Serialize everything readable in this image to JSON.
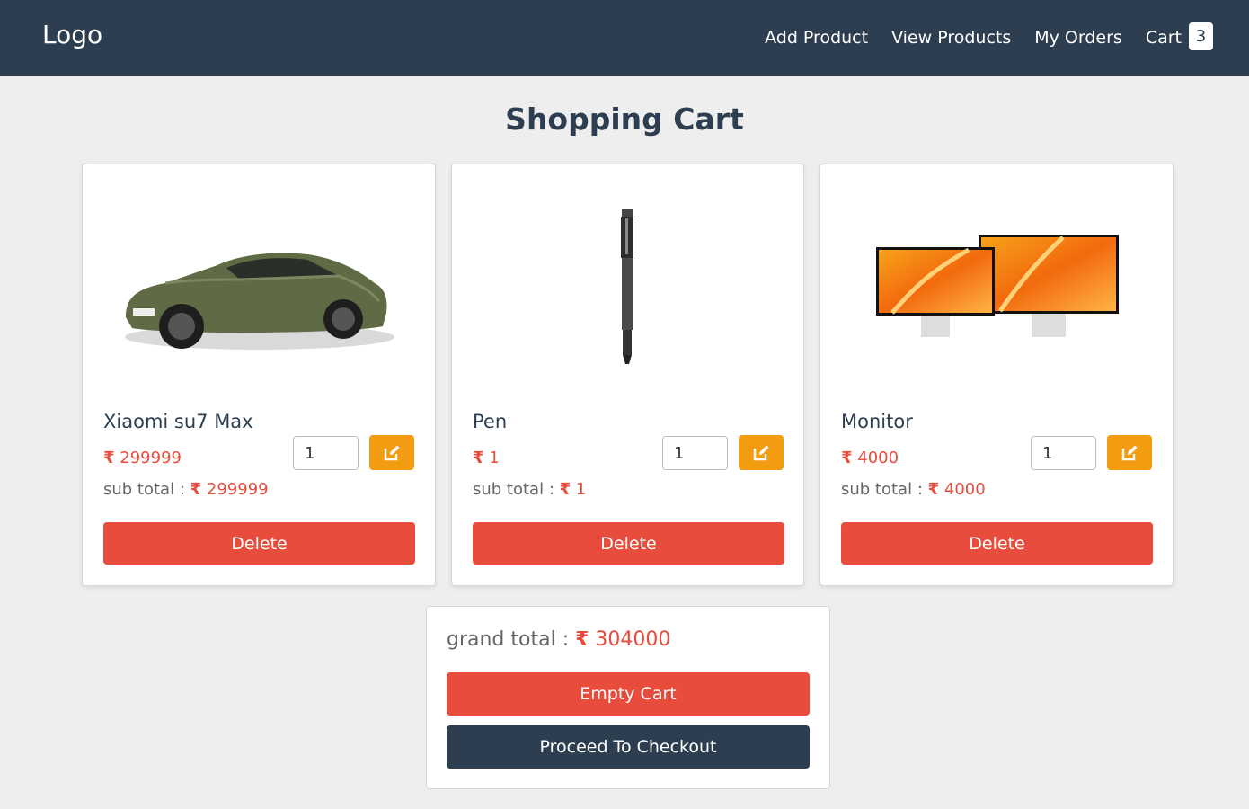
{
  "navbar": {
    "logo": "Logo",
    "links": [
      "Add Product",
      "View Products",
      "My Orders",
      "Cart"
    ],
    "cart_count": "3"
  },
  "page": {
    "title": "Shopping Cart"
  },
  "currency_symbol": "₹",
  "cart_items": [
    {
      "name": "Xiaomi su7 Max",
      "price": "299999",
      "quantity": "1",
      "subtotal_label": "sub total :",
      "subtotal": "299999",
      "delete_label": "Delete",
      "image": "car-image"
    },
    {
      "name": "Pen",
      "price": "1",
      "quantity": "1",
      "subtotal_label": "sub total :",
      "subtotal": "1",
      "delete_label": "Delete",
      "image": "pen-image"
    },
    {
      "name": "Monitor",
      "price": "4000",
      "quantity": "1",
      "subtotal_label": "sub total :",
      "subtotal": "4000",
      "delete_label": "Delete",
      "image": "monitor-image"
    }
  ],
  "summary": {
    "grand_total_label": "grand total :",
    "grand_total": "304000",
    "empty_cart_label": "Empty Cart",
    "checkout_label": "Proceed To Checkout"
  },
  "colors": {
    "navbar": "#2c3e50",
    "danger": "#e74c3c",
    "warning": "#f39c12",
    "background": "#eeeeee"
  }
}
